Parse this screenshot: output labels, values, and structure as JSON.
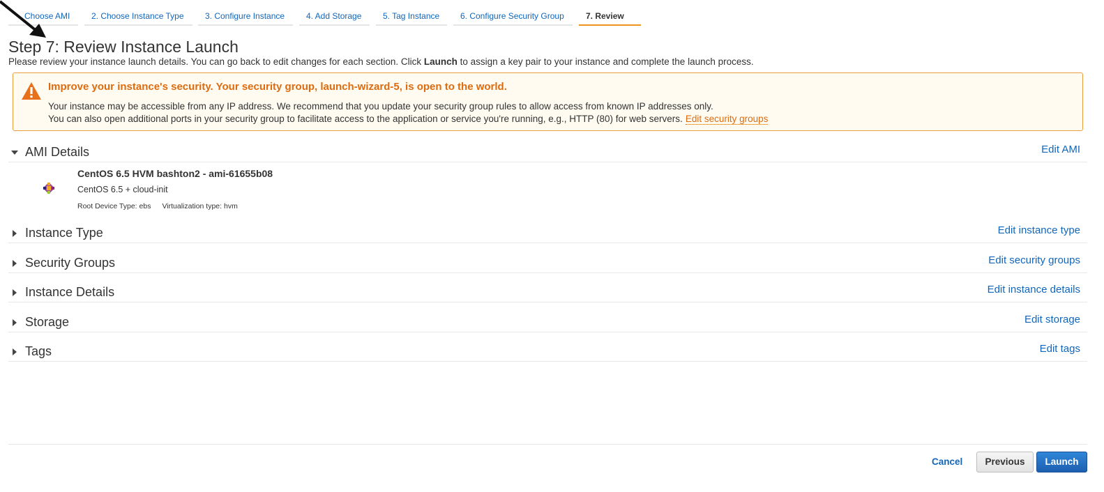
{
  "wizard": {
    "steps": [
      {
        "label": "Choose AMI"
      },
      {
        "label": "2. Choose Instance Type"
      },
      {
        "label": "3. Configure Instance"
      },
      {
        "label": "4. Add Storage"
      },
      {
        "label": "5. Tag Instance"
      },
      {
        "label": "6. Configure Security Group"
      },
      {
        "label": "7. Review"
      }
    ],
    "active_step": "7. Review"
  },
  "page": {
    "title": "Step 7: Review Instance Launch",
    "intro_before": "Please review your instance launch details. You can go back to edit changes for each section. Click ",
    "intro_bold": "Launch",
    "intro_after": " to assign a key pair to your instance and complete the launch process."
  },
  "warning": {
    "title": "Improve your instance's security. Your security group, launch-wizard-5, is open to the world.",
    "line1": "Your instance may be accessible from any IP address. We recommend that you update your security group rules to allow access from known IP addresses only.",
    "line2": "You can also open additional ports in your security group to facilitate access to the application or service you're running, e.g., HTTP (80) for web servers.",
    "link": "Edit security groups",
    "icon": "warning-triangle-icon"
  },
  "sections": {
    "ami": {
      "label": "AMI Details",
      "edit": "Edit AMI",
      "expanded": true
    },
    "instance_type": {
      "label": "Instance Type",
      "edit": "Edit instance type"
    },
    "security_groups": {
      "label": "Security Groups",
      "edit": "Edit security groups"
    },
    "instance_details": {
      "label": "Instance Details",
      "edit": "Edit instance details"
    },
    "storage": {
      "label": "Storage",
      "edit": "Edit storage"
    },
    "tags": {
      "label": "Tags",
      "edit": "Edit tags"
    }
  },
  "ami": {
    "name": "CentOS 6.5 HVM bashton2 - ami-61655b08",
    "description": "CentOS 6.5 + cloud-init",
    "root_device": "Root Device Type: ebs",
    "virtualization": "Virtualization type: hvm",
    "logo": "centos-logo-icon"
  },
  "footer": {
    "cancel": "Cancel",
    "previous": "Previous",
    "launch": "Launch"
  },
  "colors": {
    "link": "#1166bb",
    "warning": "#dd6b10",
    "active_tab": "#f0931f",
    "launch_button": "#1d5fb0"
  }
}
